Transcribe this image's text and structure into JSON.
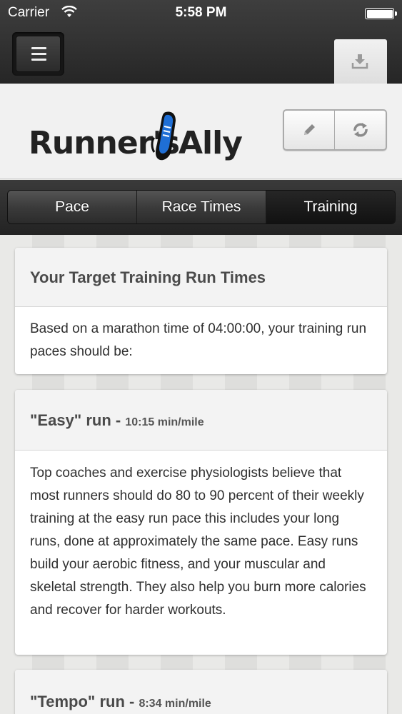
{
  "status_bar": {
    "carrier": "Carrier",
    "time": "5:58 PM"
  },
  "app": {
    "logo_left": "Runner's",
    "logo_right": "Ally"
  },
  "tabs": [
    {
      "label": "Pace",
      "active": false
    },
    {
      "label": "Race Times",
      "active": false
    },
    {
      "label": "Training",
      "active": true
    }
  ],
  "cards": [
    {
      "title": "Your Target Training Run Times",
      "pace": "",
      "body": "Based on a marathon time of 04:00:00, your training run paces should be:"
    },
    {
      "title": "\"Easy\" run - ",
      "pace": "10:15 min/mile",
      "body": "Top coaches and exercise physiologists believe that most runners should do 80 to 90 percent of their weekly training at the easy run pace this includes your long runs, done at approximately the same pace. Easy runs build your aerobic fitness, and your muscular and skeletal strength. They also help you burn more calories and recover for harder workouts."
    },
    {
      "title": "\"Tempo\" run - ",
      "pace": "8:34 min/mile",
      "body": ""
    }
  ],
  "colors": {
    "shoe_blue": "#1f6fd6",
    "shoe_dark": "#111111"
  },
  "icons": {
    "menu": "hamburger-icon",
    "download": "download-icon",
    "edit": "pencil-icon",
    "refresh": "refresh-icon"
  }
}
